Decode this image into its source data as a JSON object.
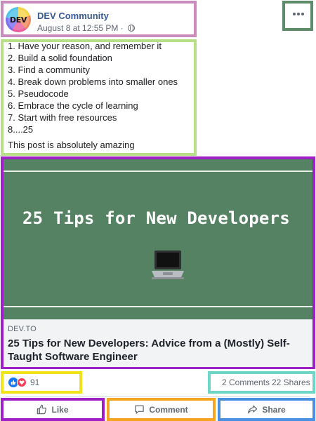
{
  "post": {
    "page_name": "DEV Community",
    "avatar_text": "DEV",
    "timestamp": "August 8 at 12:55 PM · ",
    "privacy_icon": "globe-icon",
    "lines": [
      "1. Have your reason, and remember it",
      "2. Build a solid foundation",
      "3. Find a community",
      "4. Break down problems into smaller ones",
      "5. Pseudocode",
      "6. Embrace the cycle of learning",
      "7. Start with free resources",
      "8....25"
    ],
    "footer_text": "This post is absolutely amazing"
  },
  "link_card": {
    "image_title": "25 Tips for New Developers",
    "image_icon": "laptop-icon",
    "domain": "DEV.TO",
    "headline": "25 Tips for New Developers: Advice from a (Mostly) Self-Taught Software Engineer"
  },
  "engagement": {
    "reaction_count": "91",
    "comments": "2 Comments",
    "shares": "22 Shares"
  },
  "actions": {
    "like_label": "Like",
    "comment_label": "Comment",
    "share_label": "Share"
  },
  "colors": {
    "page_name": "#385898",
    "card_image_bg": "#558263",
    "card_meta_bg": "#f2f3f5",
    "like_reaction": "#1877f2",
    "love_reaction": "#f33e58"
  }
}
